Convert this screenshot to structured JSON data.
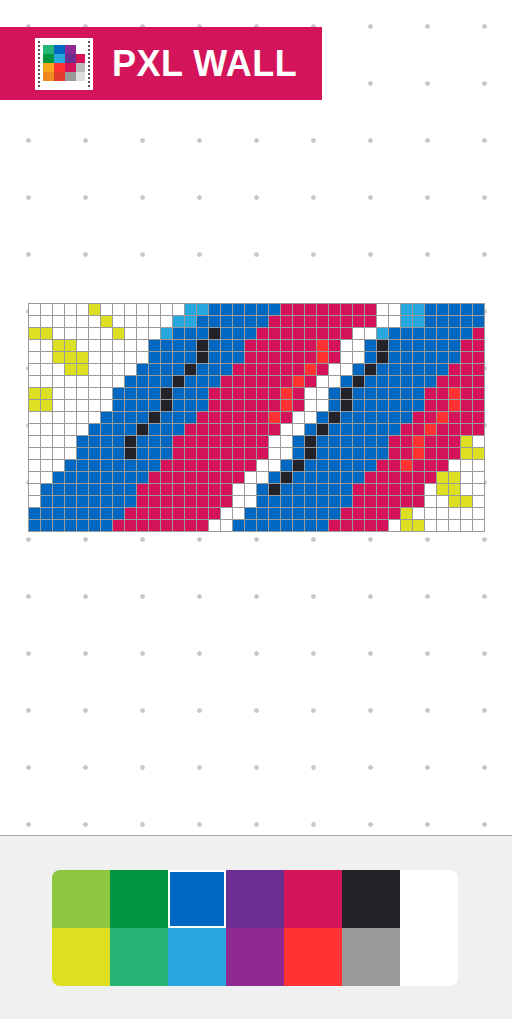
{
  "app": {
    "title": "PXL WALL"
  },
  "canvas": {
    "rows": [
      ".....7.......9922222244444444..9922222",
      "......7.....99222222444444444..99222222",
      "77.....7...9222522244444444..922222224",
      "..77......22225222444444b4..2522222244",
      "..777.....22225222444444b4..2522222244",
      "...77....22225222444444b4..25222222444",
      "........22225222444444b4..252222224444",
      "77.....22225222444444b4..2522222244b44",
      "77.....22225222444444b4..2522222244b44",
      "......22225222444444b4..2522222244b444",
      ".....2222522244444444..2522222244b4444",
      "....2222522244444444..2522222244b4447.",
      "....2222522244444444..2522222244b44477",
      "...2222222244444444..2522222244b444...",
      "..2222222244444444..2522222244444477..",
      ".2222222244444444..25222222444444.77..",
      ".2222222244444444..22222222444444..77.",
      "2222222244444444..22222222444447......",
      "222222244444444..2222222244444.77....."
    ]
  },
  "palette": [
    {
      "color": "#8dc63f",
      "selected": false
    },
    {
      "color": "#00963f",
      "selected": false
    },
    {
      "color": "#0068c0",
      "selected": true
    },
    {
      "color": "#6a2f91",
      "selected": false
    },
    {
      "color": "#d4145a",
      "selected": false
    },
    {
      "color": "#222228",
      "selected": false
    },
    {
      "color": "#ffffff",
      "selected": false
    },
    {
      "color": "#dde022",
      "selected": false
    },
    {
      "color": "#26b574",
      "selected": false
    },
    {
      "color": "#29a8e0",
      "selected": false
    },
    {
      "color": "#8e2a92",
      "selected": false
    },
    {
      "color": "#ff3333",
      "selected": false
    },
    {
      "color": "#999999",
      "selected": false
    },
    {
      "color": "#ffffff",
      "selected": false
    }
  ]
}
